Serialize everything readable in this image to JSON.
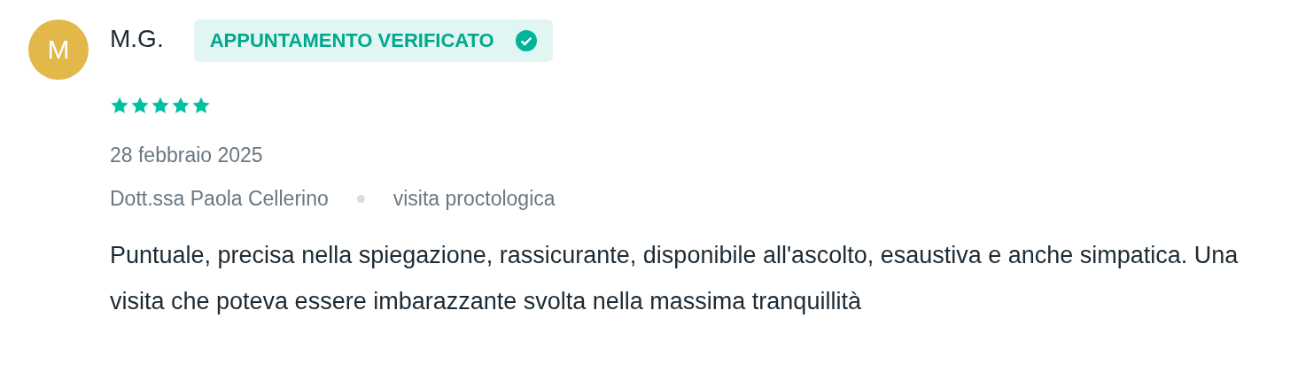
{
  "review": {
    "avatar_initial": "M",
    "author": "M.G.",
    "badge": {
      "label": "APPUNTAMENTO VERIFICATO",
      "verified": true
    },
    "stars": 5,
    "date": "28 febbraio 2025",
    "doctor": "Dott.ssa Paola Cellerino",
    "service": "visita proctologica",
    "text": "Puntuale, precisa nella spiegazione, rassicurante, disponibile all'ascolto, esaustiva e anche simpatica. Una visita che poteva essere imbarazzante svolta nella massima tranquillità"
  }
}
